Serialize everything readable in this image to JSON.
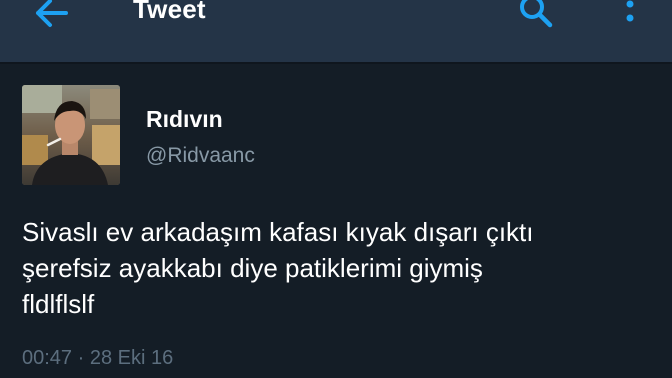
{
  "header": {
    "title": "Tweet",
    "back_icon": "arrow-left-icon",
    "search_icon": "search-icon",
    "more_icon": "more-vertical-icon",
    "accent_color": "#1da1f2"
  },
  "tweet": {
    "author": {
      "display_name": "Rıdıvın",
      "handle": "@Ridvaanc"
    },
    "text_lines": [
      "Sivaslı ev arkadaşım kafası kıyak dışarı çıktı",
      "şerefsiz ayakkabı diye patiklerimi giymiş",
      "fldlflslf"
    ],
    "timestamp": "00:47 · 28 Eki 16"
  }
}
